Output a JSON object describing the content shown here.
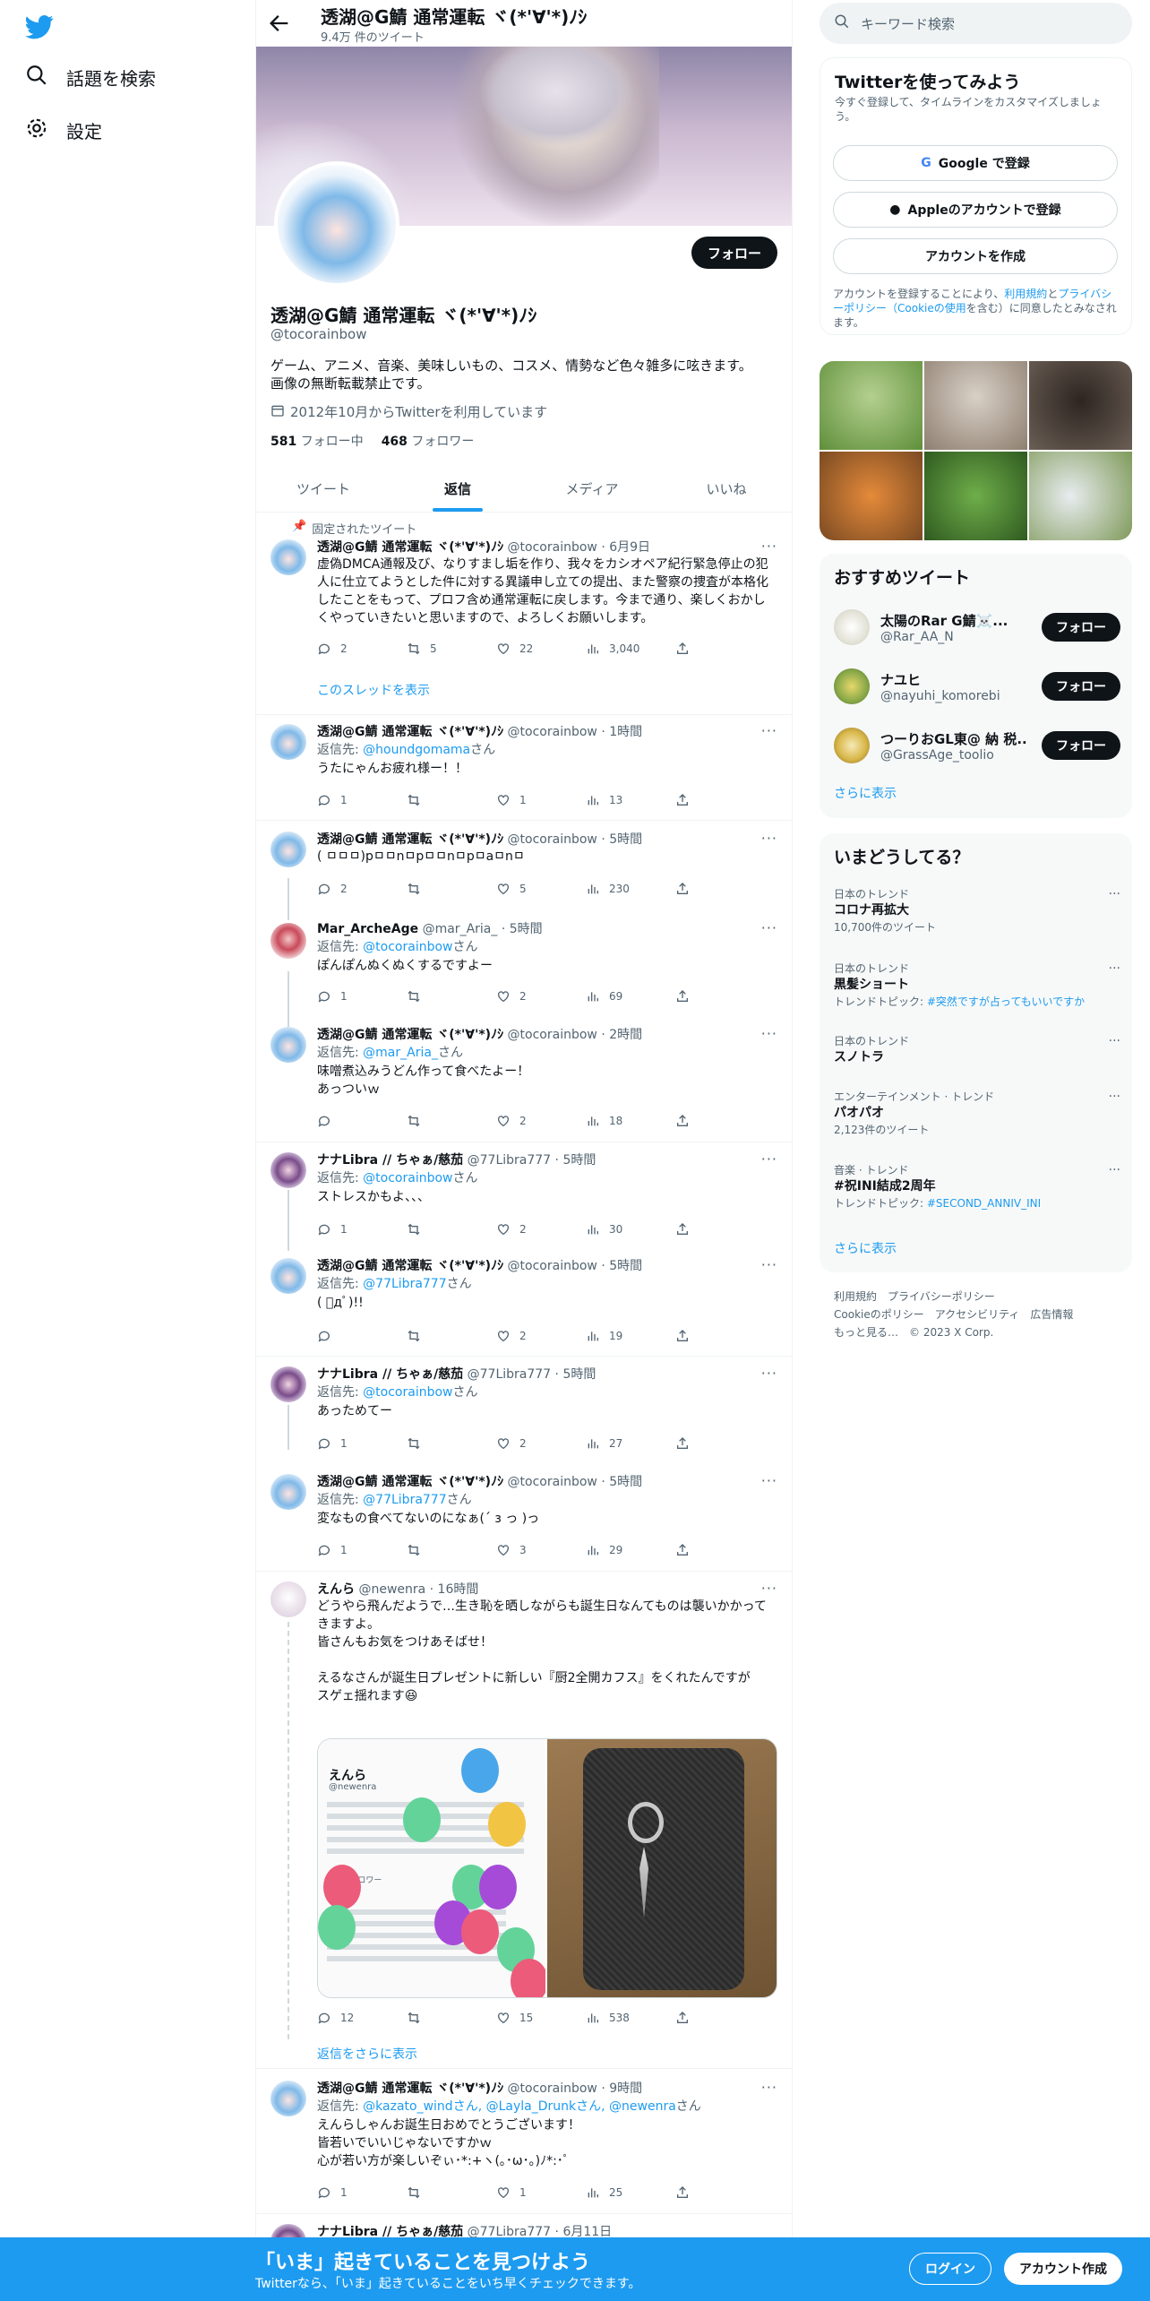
{
  "nav": {
    "search_label": "話題を検索",
    "settings_label": "設定"
  },
  "profile": {
    "name": "透湖@G鯖 通常運転 ヾ(*'∀'*)ﾉｼ",
    "tweets_count": "9.4万 件のツイート",
    "handle": "@tocorainbow",
    "follow_label": "フォロー",
    "bio": "ゲーム、アニメ、音楽、美味しいもの、コスメ、情勢など色々雑多に呟きます。\n画像の無断転載禁止です。",
    "joined": "2012年10月からTwitterを利用しています",
    "following_count": "581",
    "following_label": "フォロー中",
    "followers_count": "468",
    "followers_label": "フォロワー"
  },
  "tabs": [
    "ツイート",
    "返信",
    "メディア",
    "いいね"
  ],
  "pinned_label": "固定されたツイート",
  "show_thread": "このスレッドを表示",
  "show_more_replies": "返信をさらに表示",
  "tweets": [
    {
      "name": "透湖@G鯖 通常運転 ヾ(*'∀'*)ﾉｼ",
      "meta": "@tocorainbow · 6月9日",
      "text": "虚偽DMCA通報及び、なりすまし垢を作り、我々をカシオペア紀行緊急停止の犯人に仕立てようとした件に対する異議申し立ての提出、また警察の捜査が本格化したことをもって、プロフ含め通常運転に戻します。今まで通り、楽しくおかしくやっていきたいと思いますので、よろしくお願いします。",
      "replies": "2",
      "retweets": "5",
      "likes": "22",
      "views": "3,040"
    },
    {
      "name": "透湖@G鯖 通常運転 ヾ(*'∀'*)ﾉｼ",
      "meta": "@tocorainbow · 1時間",
      "reply_prefix": "返信先:",
      "reply_to": "@houndgomama",
      "reply_suffix": "さん",
      "text": "うたにゃんお疲れ様ー！！",
      "replies": "1",
      "retweets": "",
      "likes": "1",
      "views": "13"
    },
    {
      "name": "透湖@G鯖 通常運転 ヾ(*'∀'*)ﾉｼ",
      "meta": "@tocorainbow · 5時間",
      "text": "( ㅁㅁㅁ)pㅁㅁnㅁpㅁㅁnㅁpㅁaㅁnㅁ",
      "replies": "2",
      "retweets": "",
      "likes": "5",
      "views": "230"
    },
    {
      "name": "Mar_ArcheAge",
      "meta": "@mar_Aria_ · 5時間",
      "reply_prefix": "返信先:",
      "reply_to": "@tocorainbow",
      "reply_suffix": "さん",
      "text": "ぽんぽんぬくぬくするですよー",
      "replies": "1",
      "retweets": "",
      "likes": "2",
      "views": "69"
    },
    {
      "name": "透湖@G鯖 通常運転 ヾ(*'∀'*)ﾉｼ",
      "meta": "@tocorainbow · 2時間",
      "reply_prefix": "返信先:",
      "reply_to": "@mar_Aria_",
      "reply_suffix": "さん",
      "text": "味噌煮込みうどん作って食べたよー！\nあっついｗ",
      "replies": "",
      "retweets": "",
      "likes": "2",
      "views": "18"
    },
    {
      "name": "ナナLibra // ちゃぁ/慈茄",
      "meta": "@77Libra777 · 5時間",
      "reply_prefix": "返信先:",
      "reply_to": "@tocorainbow",
      "reply_suffix": "さん",
      "text": "ストレスかもよ、、、",
      "replies": "1",
      "retweets": "",
      "likes": "2",
      "views": "30"
    },
    {
      "name": "透湖@G鯖 通常運転 ヾ(*'∀'*)ﾉｼ",
      "meta": "@tocorainbow · 5時間",
      "reply_prefix": "返信先:",
      "reply_to": "@77Libra777",
      "reply_suffix": "さん",
      "text": "( ﾟдﾟ)!!",
      "replies": "",
      "retweets": "",
      "likes": "2",
      "views": "19"
    },
    {
      "name": "ナナLibra // ちゃぁ/慈茄",
      "meta": "@77Libra777 · 5時間",
      "reply_prefix": "返信先:",
      "reply_to": "@tocorainbow",
      "reply_suffix": "さん",
      "text": "あっためてー",
      "replies": "1",
      "retweets": "",
      "likes": "2",
      "views": "27"
    },
    {
      "name": "透湖@G鯖 通常運転 ヾ(*'∀'*)ﾉｼ",
      "meta": "@tocorainbow · 5時間",
      "reply_prefix": "返信先:",
      "reply_to": "@77Libra777",
      "reply_suffix": "さん",
      "text": "変なもの食べてないのになぁ(´ з っ )っ",
      "replies": "1",
      "retweets": "",
      "likes": "3",
      "views": "29"
    },
    {
      "name": "えんら",
      "meta": "@newenra · 16時間",
      "text": "どうやら飛んだようで…生き恥を晒しながらも誕生日なんてものは襲いかかってきますよ。\n皆さんもお気をつけあそばせ！\n\nえるなさんが誕生日プレゼントに新しい『厨2全開カフス』をくれたんですが\nスゲェ揺れます😆",
      "replies": "12",
      "retweets": "",
      "likes": "15",
      "views": "538"
    },
    {
      "name": "透湖@G鯖 通常運転 ヾ(*'∀'*)ﾉｼ",
      "meta": "@tocorainbow · 9時間",
      "reply_prefix": "返信先:",
      "reply_to": "@kazato_windさん, @Layla_Drunkさん, @newenra",
      "reply_suffix": "さん",
      "text": "えんらしゃんお誕生日おめでとうございます！\n皆若いでいいじゃないですかｗ\n心が若い方が楽しいぞぃ･*:+ヽ(｡･ω･｡)ﾉ*:･ﾟ",
      "replies": "1",
      "retweets": "",
      "likes": "1",
      "views": "25"
    },
    {
      "name": "ナナLibra // ちゃぁ/慈茄",
      "meta": "@77Libra777 · 6月11日"
    }
  ],
  "embedded_card": {
    "name": "えんら",
    "handle": "@newenra",
    "followers": "73 フォロワー"
  },
  "search": {
    "placeholder": "キーワード検索"
  },
  "signup": {
    "title": "Twitterを使ってみよう",
    "subtitle": "今すぐ登録して、タイムラインをカスタマイズしましょう。",
    "google": "Google で登録",
    "apple": "Appleのアカウントで登録",
    "create": "アカウントを作成",
    "legal_1": "アカウントを登録することにより、",
    "legal_terms": "利用規約",
    "legal_2": "と",
    "legal_privacy": "プライバシーポリシー（Cookieの使用",
    "legal_3": "を含む）に同意したとみなされます。"
  },
  "recommended": {
    "title": "おすすめツイート",
    "users": [
      {
        "name": "太陽のRar G鯖☠️...",
        "handle": "@Rar_AA_N"
      },
      {
        "name": "ナユヒ",
        "handle": "@nayuhi_komorebi"
      },
      {
        "name": "つーりおGL東@ 納 税...",
        "handle": "@GrassAge_toolio"
      }
    ],
    "follow": "フォロー",
    "more": "さらに表示"
  },
  "trends": {
    "title": "いまどうしてる？",
    "items": [
      {
        "cat": "日本のトレンド",
        "name": "コロナ再拡大",
        "sub": "10,700件のツイート"
      },
      {
        "cat": "日本のトレンド",
        "name": "黒髪ショート",
        "sub_prefix": "トレンドトピック:",
        "sub_link": "#突然ですが占ってもいいですか"
      },
      {
        "cat": "日本のトレンド",
        "name": "スノトラ"
      },
      {
        "cat": "エンターテインメント · トレンド",
        "name": "パオパオ",
        "sub": "2,123件のツイート"
      },
      {
        "cat": "音楽 · トレンド",
        "name": "#祝INI結成2周年",
        "sub_prefix": "トレンドトピック:",
        "sub_link": "#SECOND_ANNIV_INI"
      }
    ],
    "more": "さらに表示"
  },
  "footer": {
    "line1": "利用規約　プライバシーポリシー",
    "line2": "Cookieのポリシー　アクセシビリティ　広告情報",
    "line3": "もっと見る…　© 2023 X Corp."
  },
  "bottom": {
    "title": "「いま」起きていることを見つけよう",
    "subtitle": "Twitterなら、「いま」起きていることをいち早くチェックできます。",
    "login": "ログイン",
    "signup": "アカウント作成"
  },
  "colors": {
    "accent": "#1d9bf0",
    "text": "#0f1419",
    "muted": "#536471",
    "bottom_bar": "#1d9bf0"
  }
}
